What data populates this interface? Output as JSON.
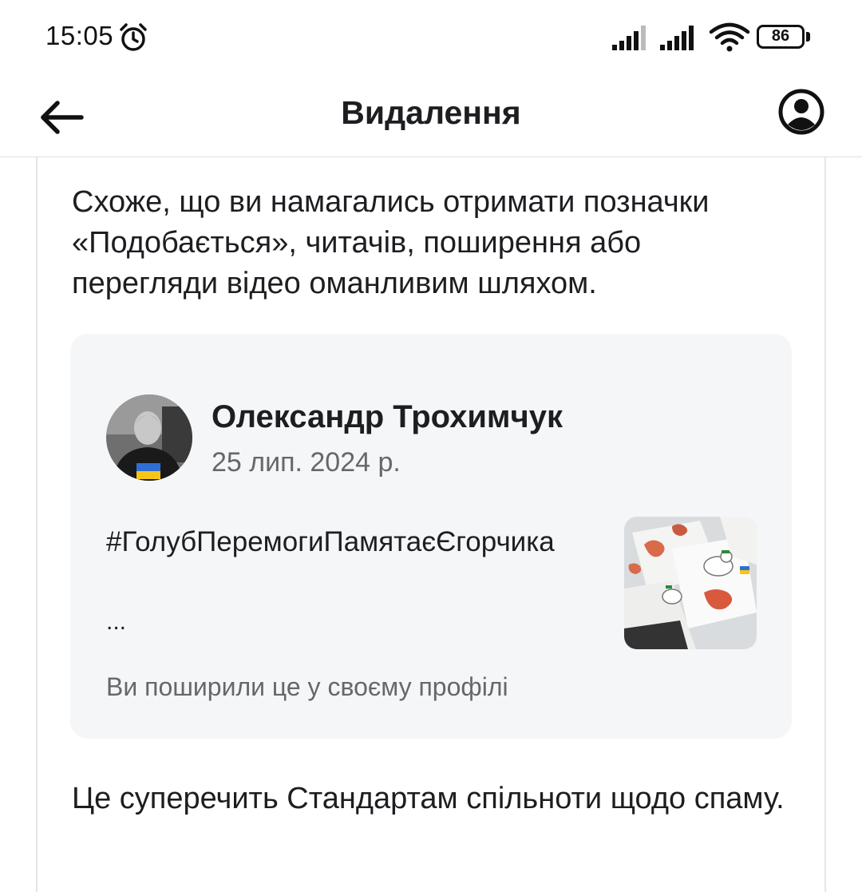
{
  "status_bar": {
    "time": "15:05",
    "battery_level": "86",
    "icons": [
      "alarm-icon",
      "signal-icon",
      "signal-icon",
      "wifi-icon",
      "battery-icon"
    ]
  },
  "header": {
    "title": "Видалення",
    "back_icon": "arrow-left-icon",
    "profile_icon": "account-circle-icon"
  },
  "content": {
    "intro": "Схоже, що ви намагались отримати позначки «Подобається», читачів, поширення або перегляди відео оманливим шляхом.",
    "post": {
      "author": "Олександр Трохимчук",
      "date": "25 лип. 2024 р.",
      "text": "#ГолубПеремогиПамятаєЄгорчика",
      "ellipsis": "...",
      "share_note": "Ви поширили це у своєму профілі"
    },
    "violation": "Це суперечить Стандартам спільноти щодо спаму."
  },
  "colors": {
    "text_primary": "#1c1e21",
    "text_secondary": "#65676b",
    "preview_background": "#f5f6f8",
    "divider": "#dddfe2"
  }
}
